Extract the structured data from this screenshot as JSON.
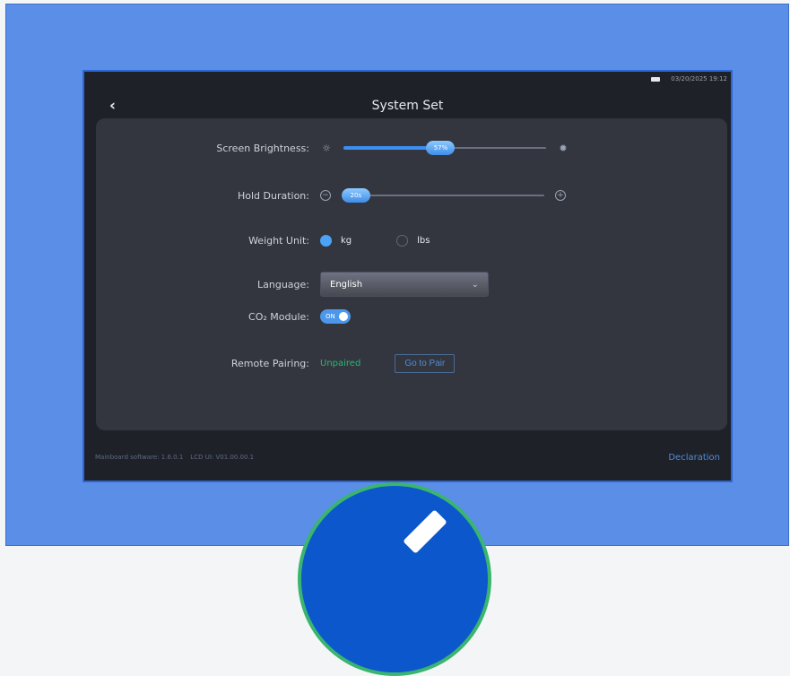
{
  "status": {
    "datetime": "03/20/2025 19:12"
  },
  "header": {
    "title": "System Set",
    "back_icon": "chevron-left-icon"
  },
  "settings": {
    "brightness": {
      "label": "Screen Brightness:",
      "value_label": "57%",
      "level": 0.48
    },
    "hold": {
      "label": "Hold Duration:",
      "value_label": "20s",
      "level": 0.07
    },
    "weight": {
      "label": "Weight Unit:",
      "options": [
        "kg",
        "lbs"
      ],
      "selected": "kg"
    },
    "language": {
      "label": "Language:",
      "selected": "English"
    },
    "co2": {
      "label": "CO₂ Module:",
      "toggle_text": "ON",
      "on": true
    },
    "remote": {
      "label": "Remote Pairing:",
      "status": "Unpaired",
      "button": "Go to Pair"
    }
  },
  "footer": {
    "mainboard": "Mainboard software: 1.6.0.1",
    "lcd": "LCD UI: V01.00.00.1",
    "declaration": "Declaration"
  },
  "colors": {
    "accent": "#3c8ff0",
    "unpaired": "#2bb673",
    "background": "#5b8ee6"
  }
}
